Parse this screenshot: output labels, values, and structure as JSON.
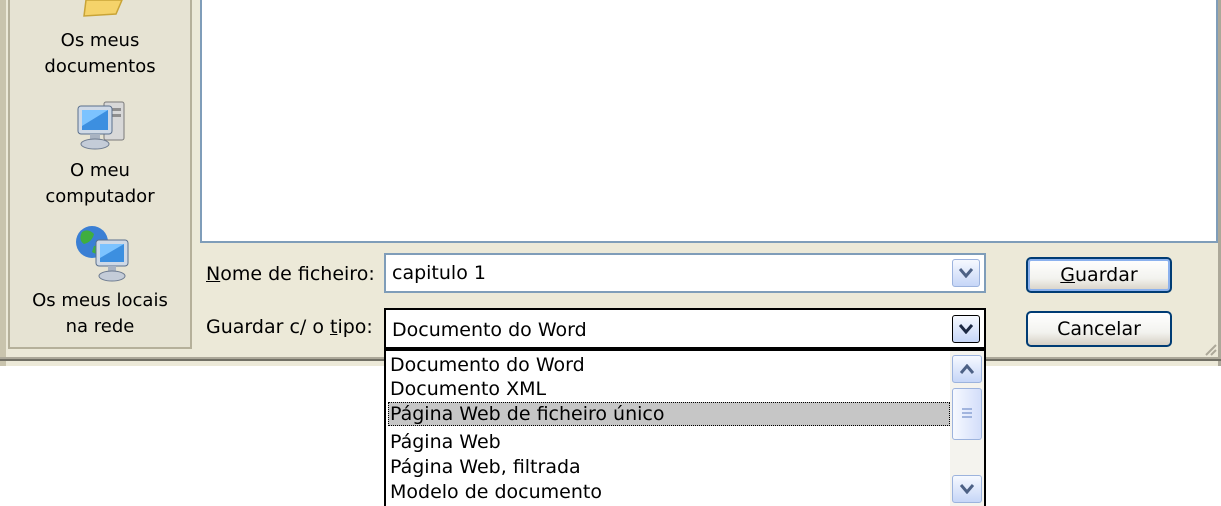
{
  "places_bar": {
    "items": [
      {
        "label": "Os meus\ndocumentos",
        "icon": "folder-icon"
      },
      {
        "label": "O meu\ncomputador",
        "icon": "computer-icon"
      },
      {
        "label": "Os meus locais\nna rede",
        "icon": "network-places-icon"
      }
    ]
  },
  "form": {
    "filename_label_accel": "N",
    "filename_label_rest": "ome de ficheiro:",
    "filename_value": "capitulo 1",
    "filetype_label_pre": "Guardar c/ o ",
    "filetype_label_accel": "t",
    "filetype_label_rest": "ipo:",
    "filetype_value": "Documento do Word"
  },
  "buttons": {
    "save_accel": "G",
    "save_rest": "uardar",
    "cancel": "Cancelar"
  },
  "dropdown": {
    "options": [
      "Documento do Word",
      "Documento XML",
      "Página Web de ficheiro único",
      "Página Web",
      "Página Web, filtrada",
      "Modelo de documento"
    ],
    "selected_index": 2
  },
  "colors": {
    "dialog_bg": "#ece9d8",
    "field_border": "#7f9db9",
    "button_border": "#003c74",
    "selection_bg": "#c6c6c6"
  }
}
